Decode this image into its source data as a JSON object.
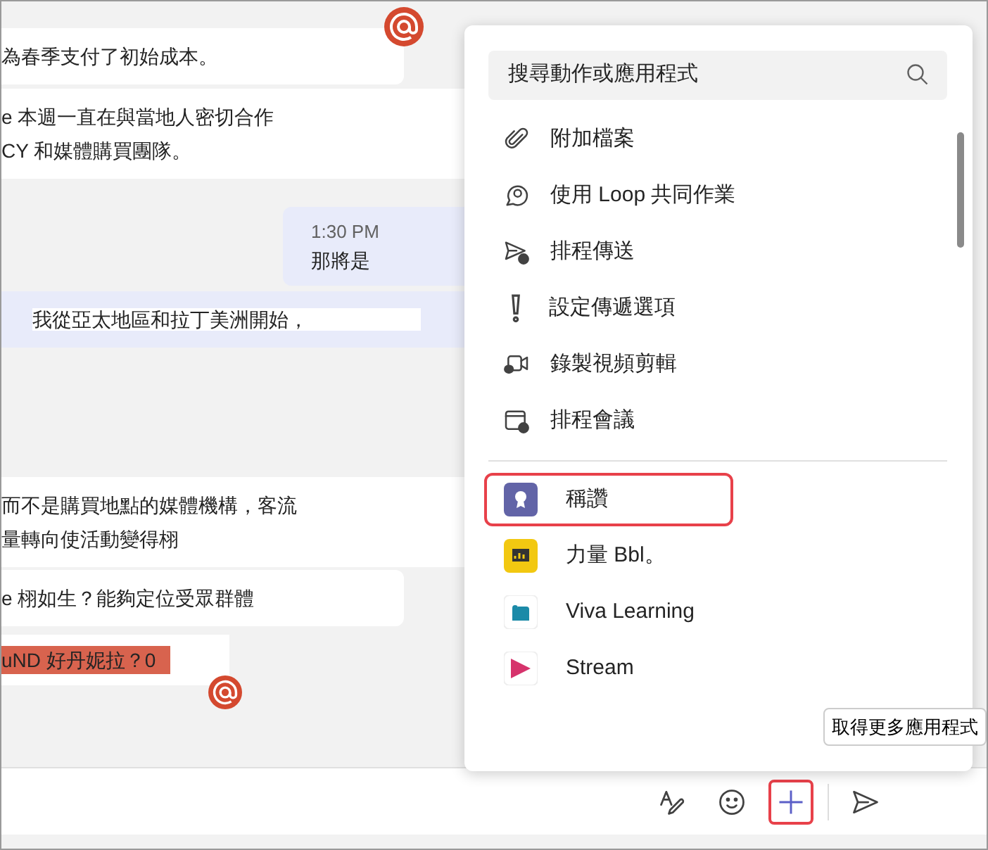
{
  "messages": [
    {
      "kind": "bubble",
      "lines": [
        "為春季支付了初始成本。"
      ]
    },
    {
      "kind": "band",
      "lines": [
        "e 本週一直在與當地人密切合作",
        "CY 和媒體購買團隊。"
      ]
    },
    {
      "kind": "outgoing",
      "time": "1:30 PM",
      "lines": [
        "那將是"
      ]
    },
    {
      "kind": "tinted",
      "lines": [
        "我從亞太地區和拉丁美洲開始，"
      ]
    },
    {
      "kind": "gap"
    },
    {
      "kind": "band",
      "lines": [
        "而不是購買地點的媒體機構，客流",
        "量轉向使活動變得栩"
      ]
    },
    {
      "kind": "bubble",
      "lines": [
        "e 栩如生？能夠定位受眾群體"
      ]
    },
    {
      "kind": "highlight",
      "lines": [
        "uND 好丹妮拉？0"
      ]
    }
  ],
  "compose_toolbar": [
    {
      "kind": "format",
      "selected": false
    },
    {
      "kind": "emoji",
      "selected": false
    },
    {
      "kind": "plus",
      "selected": true
    },
    {
      "kind": "send",
      "selected": false
    }
  ],
  "menu": {
    "search": {
      "placeholder": "搜尋動作或應用程式"
    },
    "actions": [
      {
        "kind": "attach",
        "label": "附加檔案"
      },
      {
        "kind": "loop",
        "label": "使用 Loop 共同作業"
      },
      {
        "kind": "schedule-send",
        "label": "排程傳送"
      },
      {
        "kind": "delivery",
        "label": "設定傳遞選項"
      },
      {
        "kind": "video",
        "label": "錄製視頻剪輯"
      },
      {
        "kind": "meeting",
        "label": "排程會議"
      }
    ],
    "apps": [
      {
        "kind": "praise",
        "label": "稱讚",
        "selected": true
      },
      {
        "kind": "chart",
        "label": "力量 Bbl。",
        "selected": false
      },
      {
        "kind": "learning",
        "label": "Viva Learning",
        "selected": false
      },
      {
        "kind": "stream",
        "label": "Stream",
        "selected": false
      }
    ],
    "more_button": "取得更多應用程式"
  }
}
